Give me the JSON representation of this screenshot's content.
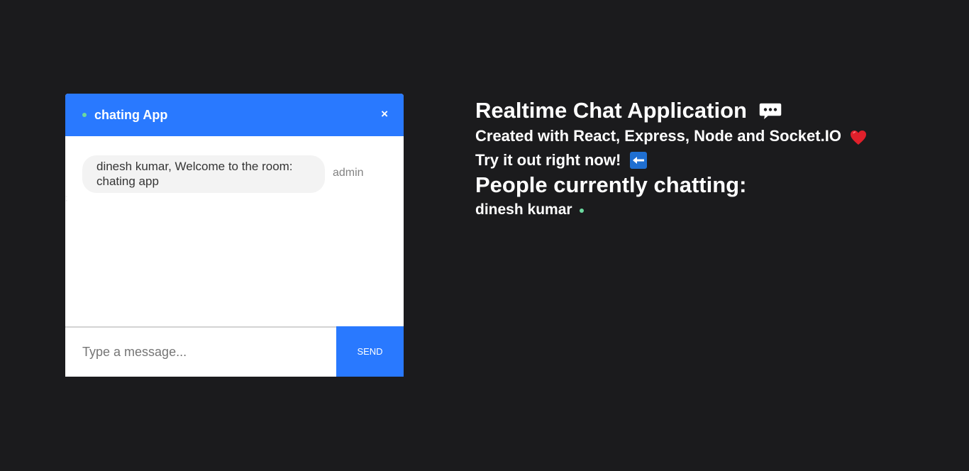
{
  "chat": {
    "title": "chating App",
    "close_label": "×",
    "messages": [
      {
        "text": "dinesh kumar, Welcome to the room: chating app",
        "sender": "admin"
      }
    ],
    "composer": {
      "placeholder": "Type a message...",
      "send_label": "SEND"
    },
    "stray_mark": ";"
  },
  "info": {
    "heading": "Realtime Chat Application",
    "subheading": "Created with React, Express, Node and Socket.IO",
    "cta": "Try it out right now!",
    "people_title": "People currently chatting:",
    "users": [
      "dinesh kumar"
    ]
  },
  "icons": {
    "header_status": "online-dot",
    "close": "close-icon",
    "heading_emoji": "speech-bubble-icon",
    "subheading_emoji": "heart-icon",
    "cta_emoji": "left-arrow-icon",
    "user_status": "online-dot"
  },
  "colors": {
    "background": "#1b1b1d",
    "accent": "#2979ff",
    "online": "#6bd99f",
    "bubble": "#f3f3f3"
  }
}
